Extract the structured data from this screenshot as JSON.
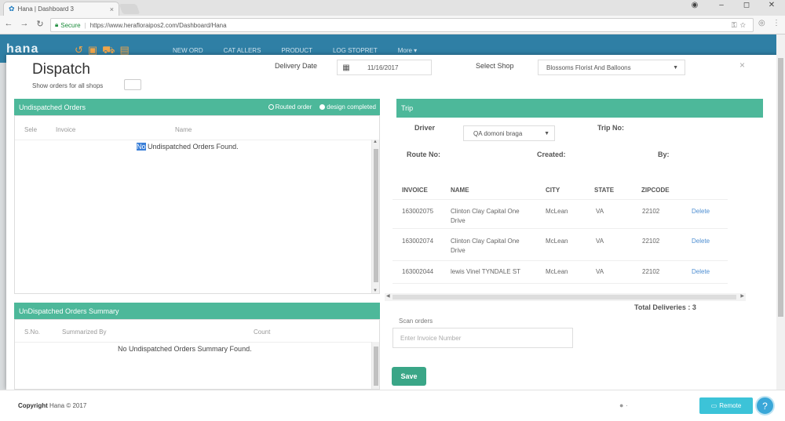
{
  "browser": {
    "tab_title": "Hana | Dashboard 3",
    "tab_close": "×",
    "secure_label": "Secure",
    "url": "https://www.herafloraipos2.com/Dashboard/Hana",
    "controls": {
      "minimize": "–",
      "maximize": "◻",
      "close": "✕",
      "account": "◉"
    }
  },
  "app": {
    "logo": "hana",
    "nav": [
      "NEW ORD",
      "CAT ALLERS",
      "PRODUCT",
      "LOG STOPRET",
      "More ▾"
    ]
  },
  "modal": {
    "title": "Dispatch",
    "show_all_label": "Show orders for all shops",
    "close": "×",
    "delivery_date_label": "Delivery Date",
    "delivery_date_value": "11/16/2017",
    "select_shop_label": "Select Shop",
    "shop_value": "Blossoms Florist And Balloons"
  },
  "undispatched": {
    "title": "Undispatched Orders",
    "legend_routed": "Routed order",
    "legend_design": "design completed",
    "columns": [
      "Sele",
      "Invoice",
      "Name"
    ],
    "empty_highlight": "No",
    "empty_rest": " Undispatched Orders Found."
  },
  "summary": {
    "title": "UnDispatched Orders Summary",
    "columns": [
      "S.No.",
      "Summarized By",
      "Count"
    ],
    "empty": "No Undispatched Orders Summary Found."
  },
  "trip": {
    "title": "Trip",
    "driver_label": "Driver",
    "driver_value": "QA domoni braga",
    "trip_no_label": "Trip No:",
    "route_no_label": "Route No:",
    "created_label": "Created:",
    "by_label": "By:",
    "columns": [
      "INVOICE",
      "NAME",
      "CITY",
      "STATE",
      "ZIPCODE"
    ],
    "rows": [
      {
        "invoice": "163002075",
        "name1": "Clinton Clay Capital One",
        "name2": "Drive",
        "city": "McLean",
        "state": "VA",
        "zip": "22102",
        "action": "Delete"
      },
      {
        "invoice": "163002074",
        "name1": "Clinton Clay Capital One",
        "name2": "Drive",
        "city": "McLean",
        "state": "VA",
        "zip": "22102",
        "action": "Delete"
      },
      {
        "invoice": "163002044",
        "name1": "lewis Vinel TYNDALE ST",
        "name2": "",
        "city": "McLean",
        "state": "VA",
        "zip": "22102",
        "action": "Delete"
      }
    ],
    "total_label": "Total Deliveries : 3",
    "scan_label": "Scan orders",
    "scan_placeholder": "Enter Invoice Number",
    "save_label": "Save"
  },
  "footer": {
    "copyright_prefix": "Copyright",
    "copyright_rest": " Hana © 2017",
    "remote_label": "Remote",
    "help_glyph": "?"
  }
}
